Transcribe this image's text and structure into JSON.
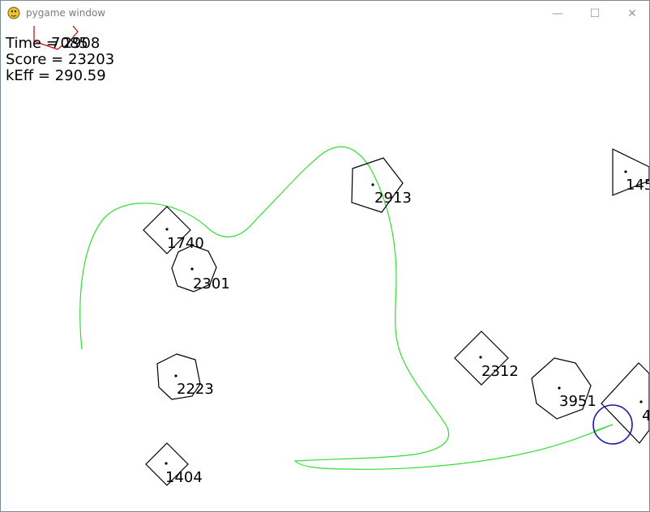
{
  "window": {
    "title": "pygame window",
    "minimize_glyph": "—",
    "maximize_glyph": "☐",
    "close_glyph": "✕",
    "icon": "pygame-snake-icon"
  },
  "hud": {
    "time_label": "Time = 2908",
    "time_overlap_label": "7085",
    "score_label": "Score = 23203",
    "keff_label": "kEff = 290.59"
  },
  "colors": {
    "trail": "#33dd33",
    "player": "#1a1aa8",
    "hud_marker": "#cc0000",
    "obstacle_stroke": "#000000"
  },
  "obstacles": [
    {
      "label": "2913",
      "shape": "pentagon"
    },
    {
      "label": "145",
      "shape": "triangle"
    },
    {
      "label": "1740",
      "shape": "square"
    },
    {
      "label": "2301",
      "shape": "heptagon"
    },
    {
      "label": "2312",
      "shape": "square"
    },
    {
      "label": "3951",
      "shape": "heptagon"
    },
    {
      "label": "4",
      "shape": "square"
    },
    {
      "label": "2223",
      "shape": "hexagon"
    },
    {
      "label": "1404",
      "shape": "square"
    }
  ]
}
